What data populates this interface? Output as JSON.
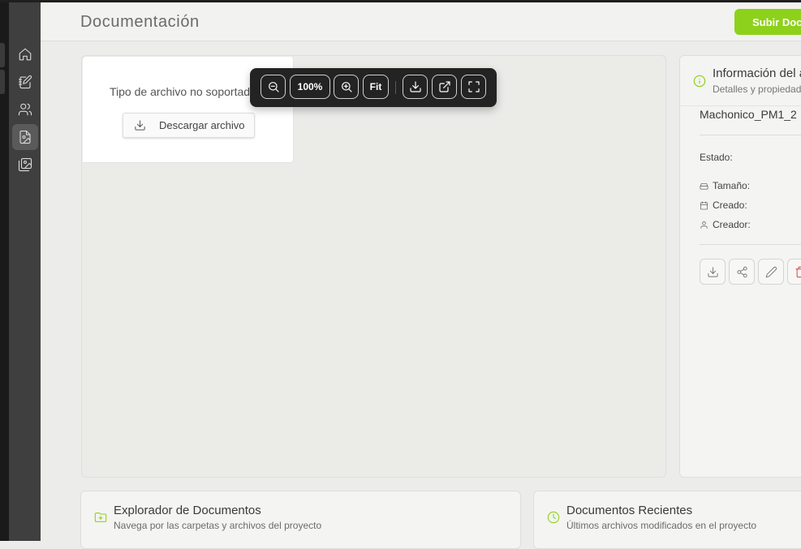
{
  "header": {
    "title": "Documentación",
    "upload_label": "Subir Documento",
    "accent_color": "#8ed11a"
  },
  "sidebar": {
    "items": [
      {
        "name": "home",
        "icon": "home-icon"
      },
      {
        "name": "notes",
        "icon": "notebook-pen-icon"
      },
      {
        "name": "users",
        "icon": "users-icon"
      },
      {
        "name": "documents",
        "icon": "file-image-icon",
        "active": true
      },
      {
        "name": "gallery",
        "icon": "images-icon"
      }
    ]
  },
  "viewer": {
    "unsupported_text": "Tipo de archivo no soportado",
    "download_label": "Descargar archivo",
    "toolbar": {
      "zoom_out": "zoom-out-icon",
      "zoom_level": "100%",
      "zoom_in": "zoom-in-icon",
      "fit_label": "Fit",
      "download": "download-icon",
      "open_external": "external-link-icon",
      "fullscreen": "fullscreen-icon"
    }
  },
  "info_panel": {
    "title": "Información del archivo",
    "subtitle": "Detalles y propiedades",
    "file_name": "Machonico_PM1_2",
    "status_label": "Estado:",
    "size_label": "Tamaño:",
    "created_label": "Creado:",
    "creator_label": "Creador:",
    "actions": [
      "download-icon",
      "share-icon",
      "edit-icon",
      "trash-icon"
    ],
    "delete_color": "#d83a3a"
  },
  "explorer_card": {
    "title": "Explorador de Documentos",
    "subtitle": "Navega por las carpetas y archivos del proyecto"
  },
  "recent_card": {
    "title": "Documentos Recientes",
    "subtitle": "Últimos archivos modificados en el proyecto"
  }
}
